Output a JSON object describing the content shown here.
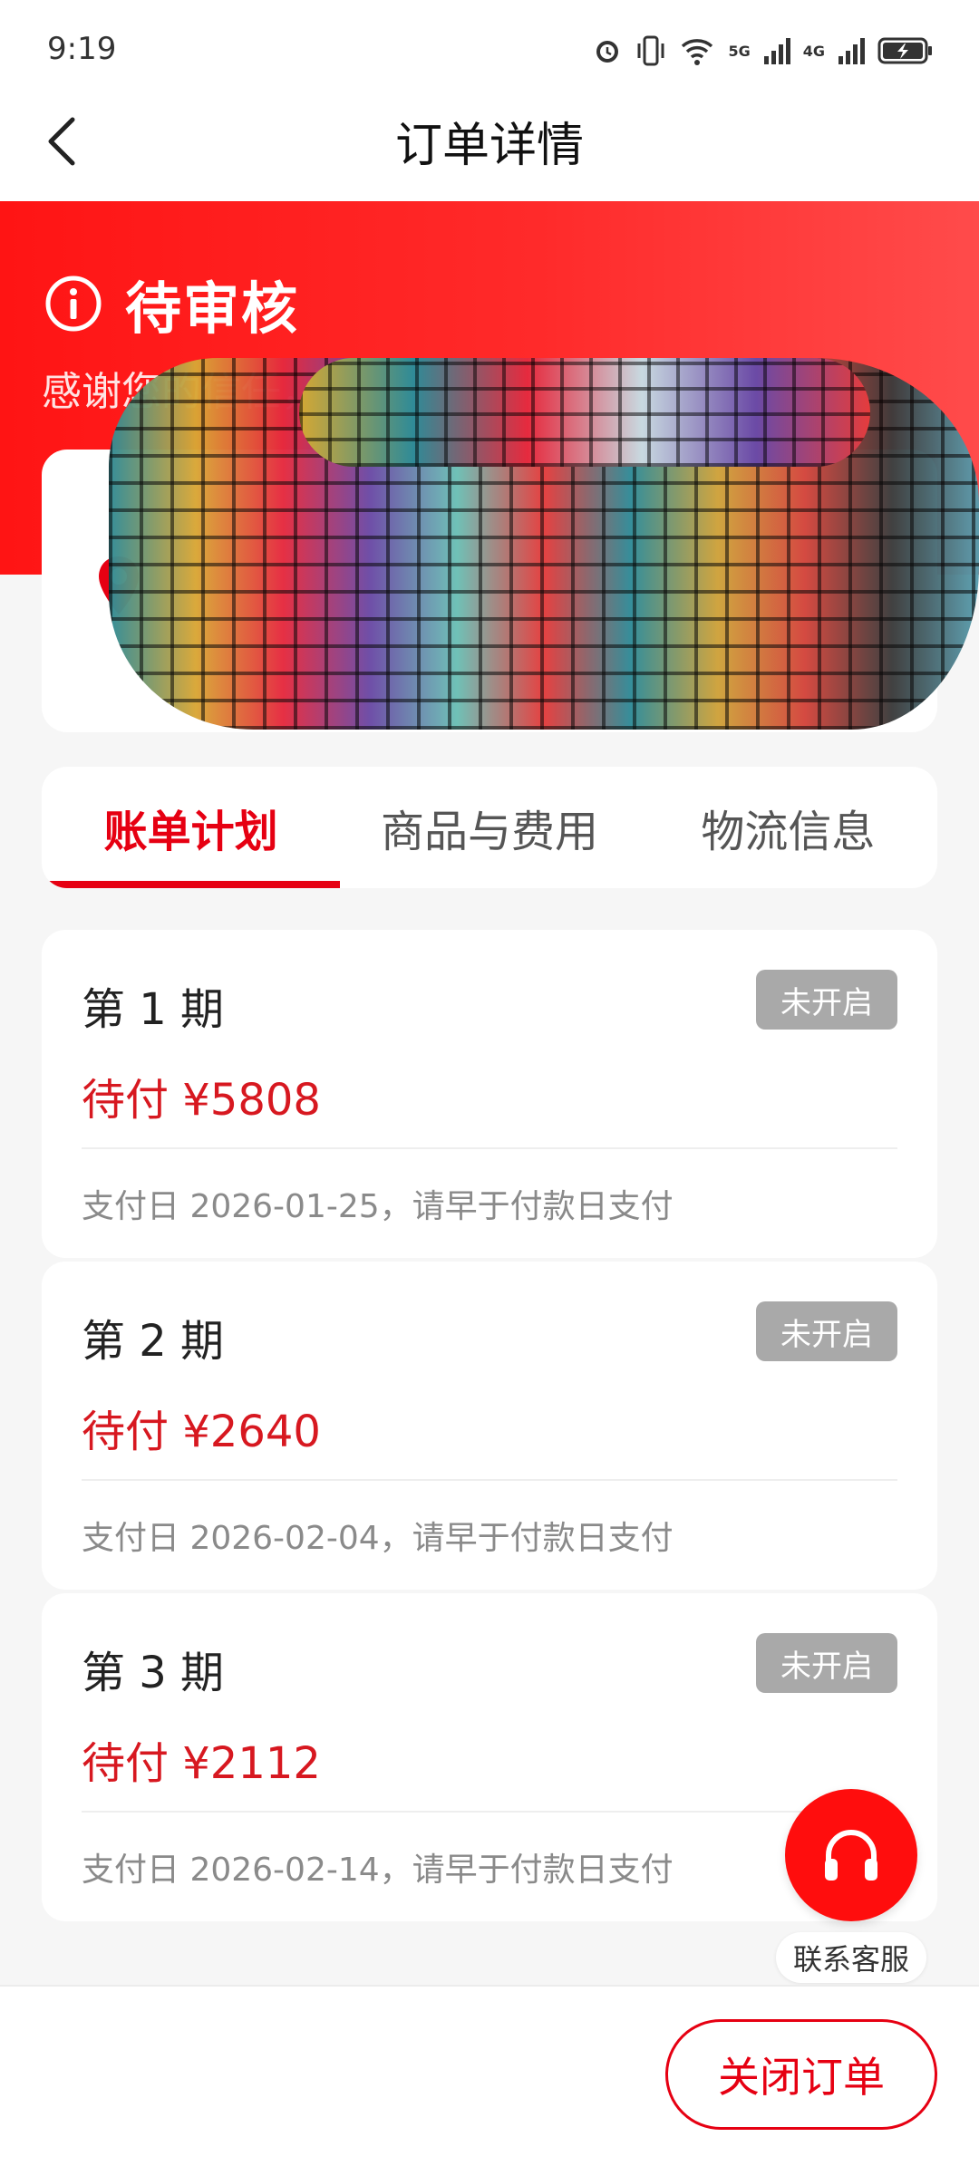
{
  "status_bar": {
    "time": "9:19",
    "net1": "5G",
    "net2": "4G"
  },
  "header": {
    "title": "订单详情"
  },
  "order_status": {
    "label": "待审核",
    "message": "感谢您的信任，订单"
  },
  "tabs": [
    {
      "label": "账单计划",
      "active": true
    },
    {
      "label": "商品与费用",
      "active": false
    },
    {
      "label": "物流信息",
      "active": false
    }
  ],
  "installments": [
    {
      "period": "第 1 期",
      "status": "未开启",
      "amount": "待付 ¥5808",
      "note": "支付日 2026-01-25，请早于付款日支付"
    },
    {
      "period": "第 2 期",
      "status": "未开启",
      "amount": "待付 ¥2640",
      "note": "支付日 2026-02-04，请早于付款日支付"
    },
    {
      "period": "第 3 期",
      "status": "未开启",
      "amount": "待付 ¥2112",
      "note": "支付日 2026-02-14，请早于付款日支付"
    }
  ],
  "service": {
    "label": "联系客服"
  },
  "footer": {
    "close_label": "关闭订单"
  },
  "colors": {
    "accent": "#e60012",
    "badge": "#a9a9a9"
  }
}
